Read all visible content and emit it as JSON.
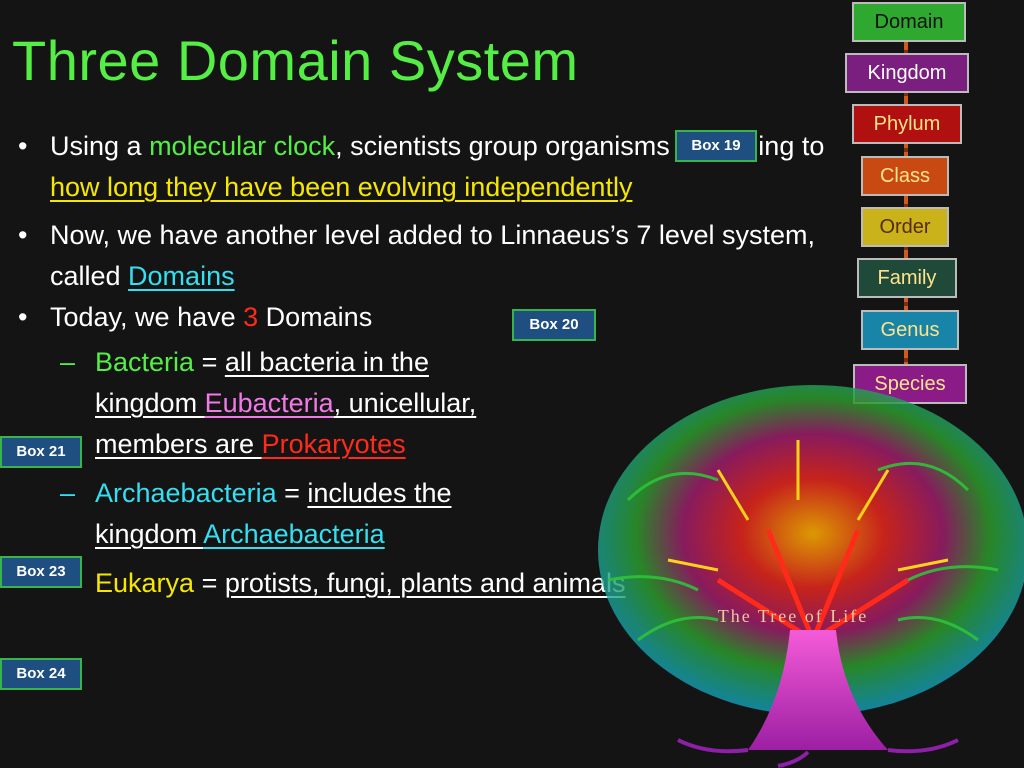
{
  "slide": {
    "title": "Three Domain System",
    "bullets": {
      "b1": {
        "t1": "Using a ",
        "t2": "molecular clock",
        "t3": ", scientists group organisms according to ",
        "t4": "how long they have been evolving independently"
      },
      "b2": {
        "t1": "Now, we have another level added to Linnaeus’s 7 level system, called ",
        "t2": "Domains"
      },
      "b3": {
        "t1": "Today, we have ",
        "t2": "3",
        "t3": " Domains"
      }
    },
    "domains": {
      "bacteria": {
        "name": "Bacteria",
        "eq": " = ",
        "d1": "all bacteria in the kingdom ",
        "d2": "Eubacteria",
        "d3": ", unicellular, members are ",
        "d4": "Prokaryotes"
      },
      "archaea": {
        "name": "Archaebacteria",
        "eq": " = ",
        "d1": "includes the kingdom ",
        "d2": "Archaebacteria"
      },
      "eukarya": {
        "name": "Eukarya",
        "eq": " = ",
        "d1": "protists, fungi, plants and animals"
      }
    },
    "boxes": {
      "b19": "Box 19",
      "b20": "Box 20",
      "b21": "Box 21",
      "b23": "Box 23",
      "b24": "Box 24"
    },
    "taxonomy": {
      "domain": "Domain",
      "kingdom": "Kingdom",
      "phylum": "Phylum",
      "class": "Class",
      "order": "Order",
      "family": "Family",
      "genus": "Genus",
      "species": "Species"
    },
    "tree_caption": "The Tree of Life",
    "icons": {
      "tree": "tree-of-life-illustration"
    }
  }
}
